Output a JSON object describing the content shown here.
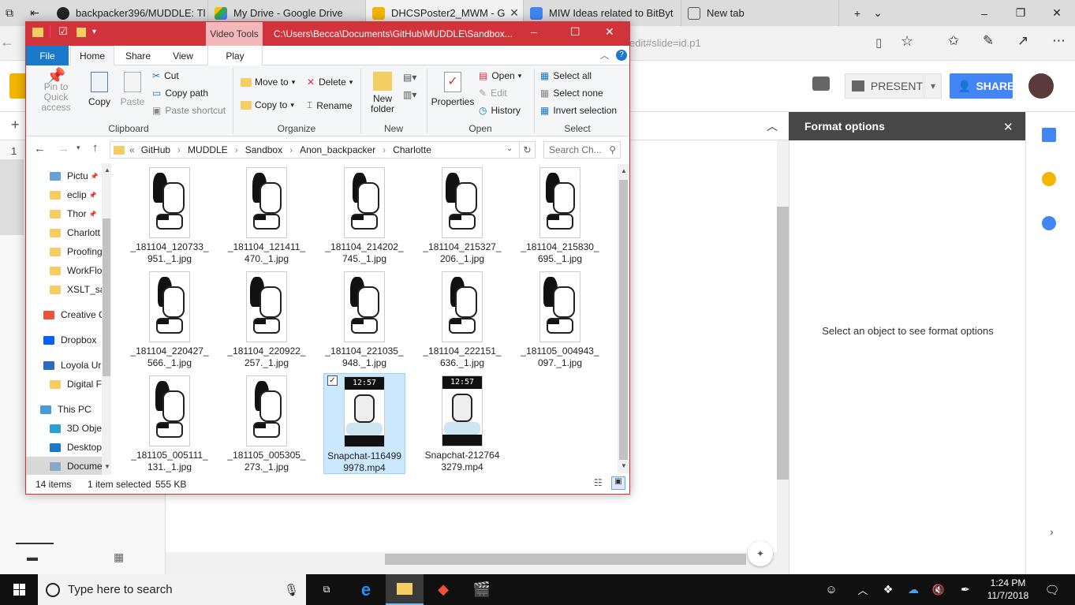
{
  "browser": {
    "tabs": [
      {
        "title": "backpacker396/MUDDLE: Tl",
        "icon": "github-icon",
        "active": false
      },
      {
        "title": "My Drive - Google Drive",
        "icon": "google-drive-icon",
        "active": false
      },
      {
        "title": "DHCSPoster2_MWM - G",
        "icon": "google-slides-icon",
        "active": true
      },
      {
        "title": "MIW Ideas related to BitByt",
        "icon": "google-docs-icon",
        "active": false
      },
      {
        "title": "New tab",
        "icon": "new-tab-icon",
        "active": false
      }
    ],
    "address_fragment": "edit#slide=id.p1"
  },
  "slides": {
    "present_label": "PRESENT",
    "share_label": "SHARE",
    "slide_number": "1",
    "format_options": {
      "title": "Format options",
      "hint": "Select an object to see format options"
    }
  },
  "explorer": {
    "title_tab": "Video Tools",
    "path_title": "C:\\Users\\Becca\\Documents\\GitHub\\MUDDLE\\Sandbox...",
    "ribbon_tabs": [
      "File",
      "Home",
      "Share",
      "View",
      "Play"
    ],
    "ribbon": {
      "clipboard": {
        "label": "Clipboard",
        "pin": "Pin to Quick access",
        "copy": "Copy",
        "paste": "Paste",
        "cut": "Cut",
        "copy_path": "Copy path",
        "paste_shortcut": "Paste shortcut"
      },
      "organize": {
        "label": "Organize",
        "move_to": "Move to",
        "copy_to": "Copy to",
        "delete": "Delete",
        "rename": "Rename"
      },
      "new": {
        "label": "New",
        "new_folder": "New folder"
      },
      "open": {
        "label": "Open",
        "properties": "Properties",
        "open": "Open",
        "edit": "Edit",
        "history": "History"
      },
      "select": {
        "label": "Select",
        "select_all": "Select all",
        "select_none": "Select none",
        "invert_selection": "Invert selection"
      }
    },
    "breadcrumb": [
      "GitHub",
      "MUDDLE",
      "Sandbox",
      "Anon_backpacker",
      "Charlotte"
    ],
    "search_placeholder": "Search Ch...",
    "nav_items": [
      {
        "label": "Pictu",
        "type": "pictures",
        "pinned": true
      },
      {
        "label": "eclip",
        "type": "folder",
        "pinned": true
      },
      {
        "label": "Thor",
        "type": "folder",
        "pinned": true
      },
      {
        "label": "Charlott",
        "type": "folder"
      },
      {
        "label": "Proofing",
        "type": "folder"
      },
      {
        "label": "WorkFlo",
        "type": "folder"
      },
      {
        "label": "XSLT_sa",
        "type": "folder"
      },
      {
        "label": "Creative C",
        "type": "creative-cloud"
      },
      {
        "label": "Dropbox",
        "type": "dropbox"
      },
      {
        "label": "Loyola Ur",
        "type": "onedrive"
      },
      {
        "label": "Digital F",
        "type": "folder"
      },
      {
        "label": "This PC",
        "type": "pc"
      },
      {
        "label": "3D Obje",
        "type": "3d"
      },
      {
        "label": "Desktop",
        "type": "desktop"
      },
      {
        "label": "Docume",
        "type": "documents"
      }
    ],
    "files": [
      {
        "line1": "_181104_120733_",
        "line2": "951._1.jpg"
      },
      {
        "line1": "_181104_121411_",
        "line2": "470._1.jpg"
      },
      {
        "line1": "_181104_214202_",
        "line2": "745._1.jpg"
      },
      {
        "line1": "_181104_215327_",
        "line2": "206._1.jpg"
      },
      {
        "line1": "_181104_215830_",
        "line2": "695._1.jpg"
      },
      {
        "line1": "_181104_220427_",
        "line2": "566._1.jpg"
      },
      {
        "line1": "_181104_220922_",
        "line2": "257._1.jpg"
      },
      {
        "line1": "_181104_221035_",
        "line2": "948._1.jpg"
      },
      {
        "line1": "_181104_222151_",
        "line2": "636._1.jpg"
      },
      {
        "line1": "_181105_004943_",
        "line2": "097._1.jpg"
      },
      {
        "line1": "_181105_005111_",
        "line2": "131._1.jpg"
      },
      {
        "line1": "_181105_005305_",
        "line2": "273._1.jpg"
      },
      {
        "line1": "Snapchat-116499",
        "line2": "9978.mp4",
        "selected": true,
        "video": true
      },
      {
        "line1": "Snapchat-212764",
        "line2": "3279.mp4",
        "video": true
      }
    ],
    "video_thumb_text": "12:57",
    "status": {
      "count": "14 items",
      "selection": "1 item selected",
      "size": "555 KB"
    }
  },
  "taskbar": {
    "search_placeholder": "Type here to search",
    "time": "1:24 PM",
    "date": "11/7/2018"
  }
}
